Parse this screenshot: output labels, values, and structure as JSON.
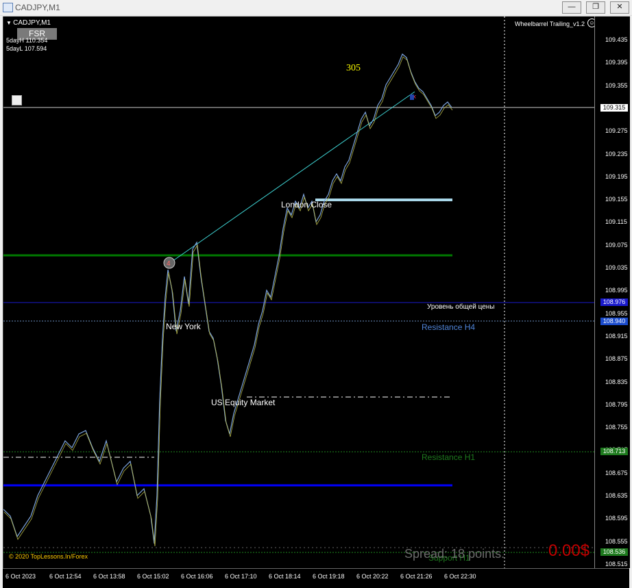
{
  "window": {
    "title": "CADJPY,M1",
    "buttons": {
      "minimize": "—",
      "restore": "❐",
      "close": "✕"
    }
  },
  "overlay": {
    "symbol": "CADJPY,M1",
    "fsr_button": "FSR",
    "day_high": "5dayH 110.354",
    "day_low": "5dayL 107.594",
    "ea_name": "Wheelbarrel Trailing_v1.2",
    "ea_status_icon": "smiley-icon",
    "count_label": "305",
    "spread": "Spread: 18 points.",
    "profit": "0.00$",
    "copyright": "© 2020 TopLessons.In/Forex"
  },
  "annotations": {
    "london_close": "London Close",
    "new_york": "New York",
    "us_equity": "US Equity Market",
    "level_ru": "Уровень общей цены",
    "resistance_h4": "Resistance H4",
    "resistance_h1": "Resistance H1",
    "support_h1": "Support H1",
    "trade_marker": "4"
  },
  "price_axis": {
    "ticks": [
      "109.435",
      "109.395",
      "109.355",
      "109.315",
      "109.275",
      "109.235",
      "109.195",
      "109.155",
      "109.115",
      "109.075",
      "109.035",
      "108.995",
      "108.955",
      "108.915",
      "108.875",
      "108.835",
      "108.795",
      "108.755",
      "108.715",
      "108.675",
      "108.635",
      "108.595",
      "108.555",
      "108.515"
    ],
    "current_price": "109.315",
    "level_price": "108.976",
    "resistance_h4_price": "108.940",
    "resistance_h1_price": "108.713",
    "support_h1_price": "108.536"
  },
  "time_axis": {
    "ticks": [
      "6 Oct 2023",
      "6 Oct 12:54",
      "6 Oct 13:58",
      "6 Oct 15:02",
      "6 Oct 16:06",
      "6 Oct 17:10",
      "6 Oct 18:14",
      "6 Oct 19:18",
      "6 Oct 20:22",
      "6 Oct 21:26",
      "6 Oct 22:30"
    ]
  },
  "colors": {
    "background": "#000000",
    "bar_up": "#7ea6e0",
    "bar_down": "#b7b74a",
    "green_level": "#007a00",
    "blue_level": "#0000ff",
    "trendline": "#3fd6d6",
    "london_line": "#a9d8ea",
    "spread_text": "#6b6b6b",
    "profit_text": "#c00000",
    "count_label": "#ffff00"
  }
}
